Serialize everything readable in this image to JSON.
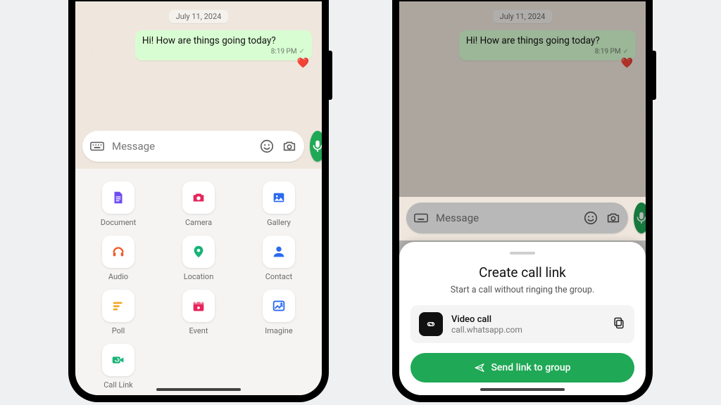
{
  "chat": {
    "date": "July 11, 2024",
    "message_text": "Hi! How are things going today?",
    "message_time": "8:19 PM",
    "input_placeholder": "Message"
  },
  "attachments": {
    "items": [
      {
        "label": "Document",
        "icon": "doc",
        "color": "#6f4cf2"
      },
      {
        "label": "Camera",
        "icon": "camera",
        "color": "#e6245b"
      },
      {
        "label": "Gallery",
        "icon": "gallery",
        "color": "#2b6af0"
      },
      {
        "label": "Audio",
        "icon": "audio",
        "color": "#f25a2a"
      },
      {
        "label": "Location",
        "icon": "location",
        "color": "#17b377"
      },
      {
        "label": "Contact",
        "icon": "contact",
        "color": "#2b6af0"
      },
      {
        "label": "Poll",
        "icon": "poll",
        "color": "#f0a92a"
      },
      {
        "label": "Event",
        "icon": "event",
        "color": "#e6245b"
      },
      {
        "label": "Imagine",
        "icon": "imagine",
        "color": "#2b6af0"
      },
      {
        "label": "Call Link",
        "icon": "calllink",
        "color": "#17b377"
      }
    ]
  },
  "call_link_sheet": {
    "title": "Create call link",
    "subtitle": "Start a call without ringing the group.",
    "type_label": "Video call",
    "url": "call.whatsapp.com",
    "button_label": "Send link to group"
  },
  "colors": {
    "accent": "#1fa855",
    "bubble": "#d9fdd3"
  }
}
